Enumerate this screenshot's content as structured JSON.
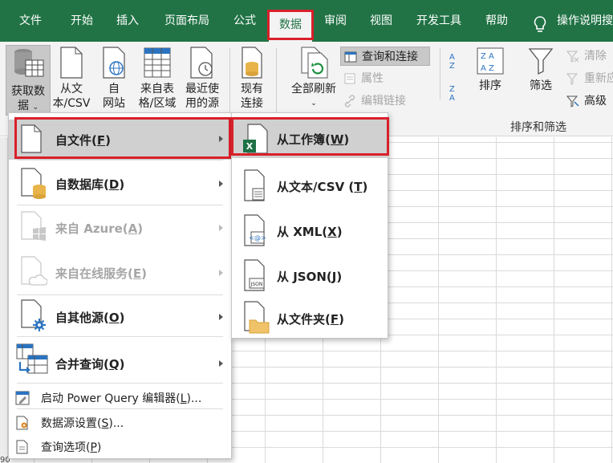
{
  "tabs": [
    "文件",
    "开始",
    "插入",
    "页面布局",
    "公式",
    "数据",
    "审阅",
    "视图",
    "开发工具",
    "帮助"
  ],
  "tell_me": "操作说明搜",
  "ribbon": {
    "get_data": {
      "line1": "获取数",
      "line2": "据"
    },
    "from_text": {
      "line1": "从文",
      "line2": "本/CSV"
    },
    "from_web": {
      "line1": "自",
      "line2": "网站"
    },
    "from_table": {
      "line1": "来自表",
      "line2": "格/区域"
    },
    "recent": {
      "line1": "最近使",
      "line2": "用的源"
    },
    "existing": {
      "line1": "现有",
      "line2": "连接"
    },
    "refresh_all": {
      "line1": "全部刷新"
    },
    "queries_connections": "查询和连接",
    "properties": "属性",
    "edit_links": "编辑链接",
    "sort": "排序",
    "filter": "筛选",
    "clear": "清除",
    "reapply": "重新应",
    "advanced": "高级",
    "group_sort_filter": "排序和筛选"
  },
  "menu_main": {
    "items": [
      {
        "label": "自文件(",
        "key": "F",
        "tail": ")",
        "disabled": false
      },
      {
        "label": "自数据库(",
        "key": "D",
        "tail": ")",
        "disabled": false
      },
      {
        "label": "来自 Azure(",
        "key": "A",
        "tail": ")",
        "disabled": true
      },
      {
        "label": "来自在线服务(",
        "key": "E",
        "tail": ")",
        "disabled": true
      },
      {
        "label": "自其他源(",
        "key": "O",
        "tail": ")",
        "disabled": false
      },
      {
        "label": "合并查询(",
        "key": "Q",
        "tail": ")",
        "disabled": false
      }
    ],
    "extra": [
      {
        "label": "启动 Power Query 编辑器(",
        "key": "L",
        "tail": ")..."
      },
      {
        "label": "数据源设置(",
        "key": "S",
        "tail": ")..."
      },
      {
        "label": "查询选项(",
        "key": "P",
        "tail": ")"
      }
    ]
  },
  "menu_sub": {
    "items": [
      {
        "label": "从工作簿(",
        "key": "W",
        "tail": ")"
      },
      {
        "label": "从文本/CSV (",
        "key": "T",
        "tail": ")"
      },
      {
        "label": "从 XML(",
        "key": "X",
        "tail": ")"
      },
      {
        "label": "从 JSON(",
        "key": "J",
        "tail": ")"
      },
      {
        "label": "从文件夹(",
        "key": "F",
        "tail": ")"
      }
    ]
  },
  "icon_labels": {
    "excel": "X",
    "xml": "<@>",
    "json": "JSON"
  },
  "row_number": "90",
  "colors": {
    "excel_green": "#217346",
    "highlight_red": "#d9202a",
    "menu_highlight": "#d0d0d0",
    "disabled": "#a6a6a6"
  }
}
